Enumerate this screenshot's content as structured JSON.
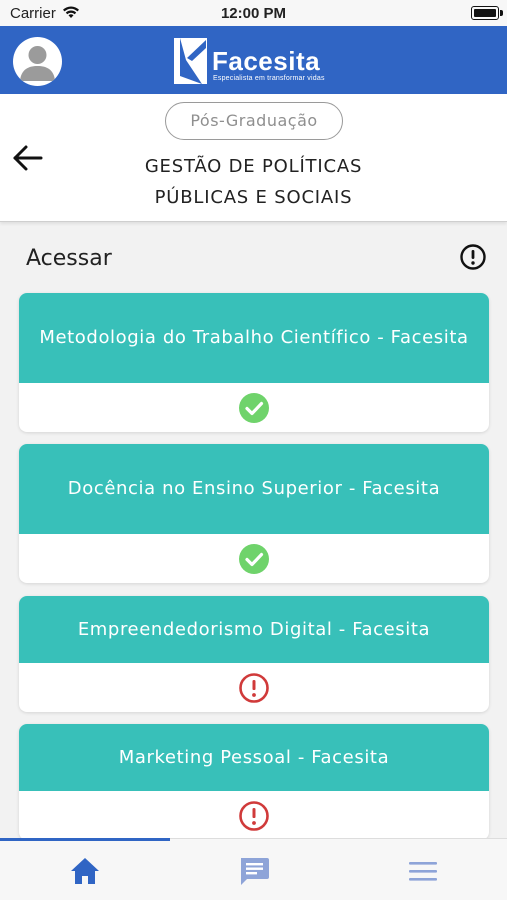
{
  "status_bar": {
    "carrier": "Carrier",
    "time": "12:00 PM"
  },
  "header": {
    "brand": "Facesita",
    "tagline": "Especialista em transformar vidas",
    "brand_color": "#3065c4"
  },
  "course": {
    "category": "Pós-Graduação",
    "title_line1": "GESTÃO DE POLÍTICAS",
    "title_line2": "PÚBLICAS E SOCIAIS"
  },
  "section": {
    "title": "Acessar",
    "info_icon": "exclamation-circle-icon"
  },
  "colors": {
    "card_header": "#38c0b9",
    "status_ok": "#6fd36b",
    "status_pending": "#d03a3a",
    "nav_active": "#3065c4",
    "nav_inactive": "#8ea4d8"
  },
  "modules": [
    {
      "name": "Metodologia do Trabalho Científico - Facesita",
      "status": "completed",
      "status_icon": "check-circle-icon"
    },
    {
      "name": "Docência no Ensino Superior - Facesita",
      "status": "completed",
      "status_icon": "check-circle-icon"
    },
    {
      "name": "Empreendedorismo Digital - Facesita",
      "status": "pending",
      "status_icon": "exclamation-circle-icon"
    },
    {
      "name": "Marketing Pessoal - Facesita",
      "status": "pending",
      "status_icon": "exclamation-circle-icon"
    }
  ],
  "nav": [
    {
      "icon": "home-icon",
      "active": true
    },
    {
      "icon": "chat-icon",
      "active": false
    },
    {
      "icon": "menu-icon",
      "active": false
    }
  ]
}
